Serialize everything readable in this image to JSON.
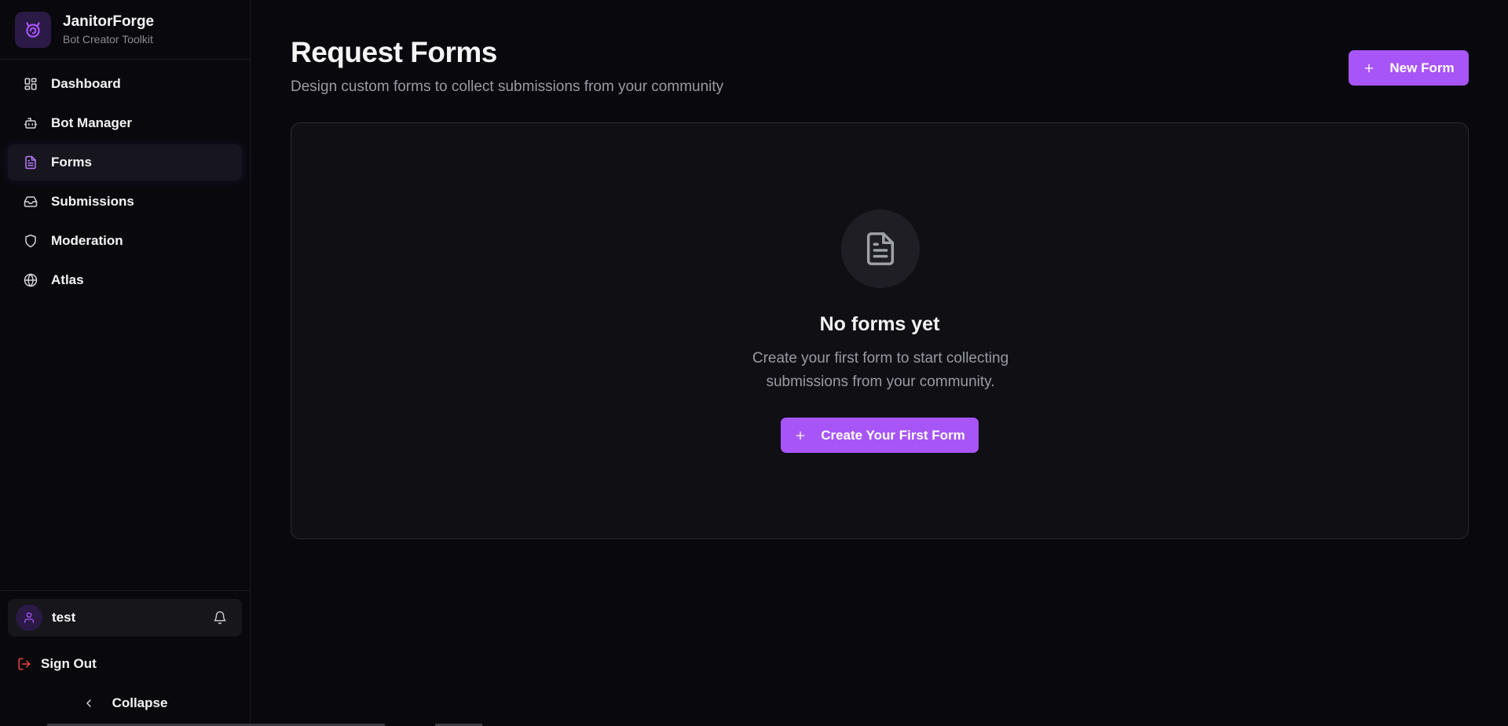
{
  "brand": {
    "name": "JanitorForge",
    "tagline": "Bot Creator Toolkit",
    "logo_icon": "spiral-cat-icon"
  },
  "sidebar": {
    "items": [
      {
        "label": "Dashboard",
        "icon": "dashboard-grid-icon",
        "active": false
      },
      {
        "label": "Bot Manager",
        "icon": "bot-icon",
        "active": false
      },
      {
        "label": "Forms",
        "icon": "file-text-icon",
        "active": true
      },
      {
        "label": "Submissions",
        "icon": "inbox-icon",
        "active": false
      },
      {
        "label": "Moderation",
        "icon": "shield-icon",
        "active": false
      },
      {
        "label": "Atlas",
        "icon": "globe-icon",
        "active": false
      }
    ],
    "user": {
      "name": "test",
      "icon": "user-icon"
    },
    "sign_out_label": "Sign Out",
    "collapse_label": "Collapse"
  },
  "main": {
    "title": "Request Forms",
    "subtitle": "Design custom forms to collect submissions from your community",
    "new_form_label": "New Form",
    "empty_state": {
      "icon": "file-text-icon",
      "title": "No forms yet",
      "description": "Create your first form to start collecting submissions from your community.",
      "cta_label": "Create Your First Form"
    }
  },
  "colors": {
    "accent": "#a855f7",
    "background": "#09090d",
    "card": "#0f0f14",
    "danger": "#ef4444"
  }
}
